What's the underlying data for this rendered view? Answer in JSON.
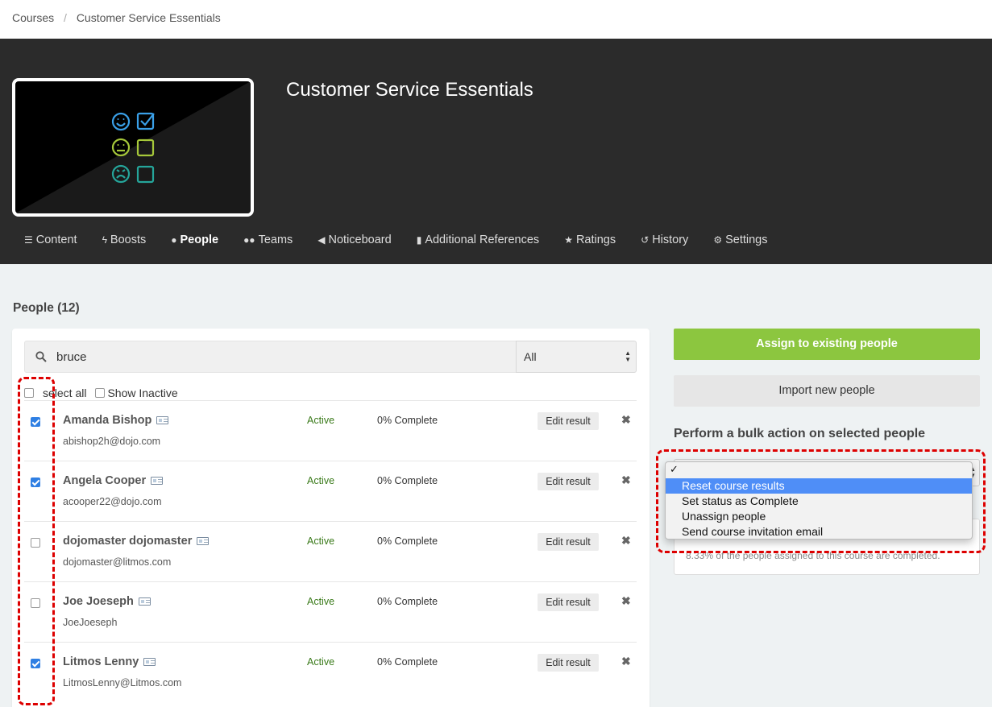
{
  "breadcrumb": {
    "root": "Courses",
    "separator": "/",
    "current": "Customer Service Essentials"
  },
  "course": {
    "title": "Customer Service Essentials"
  },
  "tabs": [
    {
      "label": "Content",
      "icon": "list-icon"
    },
    {
      "label": "Boosts",
      "icon": "bolt-icon"
    },
    {
      "label": "People",
      "icon": "user-icon",
      "active": true
    },
    {
      "label": "Teams",
      "icon": "users-icon"
    },
    {
      "label": "Noticeboard",
      "icon": "bullhorn-icon"
    },
    {
      "label": "Additional References",
      "icon": "file-icon"
    },
    {
      "label": "Ratings",
      "icon": "star-icon"
    },
    {
      "label": "History",
      "icon": "history-icon"
    },
    {
      "label": "Settings",
      "icon": "gear-icon"
    }
  ],
  "people": {
    "heading": "People (12)",
    "search_value": "bruce",
    "filter_value": "All",
    "select_all_label": "select all",
    "show_inactive_label": "Show Inactive",
    "edit_label": "Edit result",
    "rows": [
      {
        "name": "Amanda Bishop",
        "email": "abishop2h@dojo.com",
        "status": "Active",
        "progress": "0% Complete",
        "checked": true
      },
      {
        "name": "Angela Cooper",
        "email": "acooper22@dojo.com",
        "status": "Active",
        "progress": "0% Complete",
        "checked": true
      },
      {
        "name": "dojomaster dojomaster",
        "email": "dojomaster@litmos.com",
        "status": "Active",
        "progress": "0% Complete",
        "checked": false
      },
      {
        "name": "Joe Joeseph",
        "email": "JoeJoeseph",
        "status": "Active",
        "progress": "0% Complete",
        "checked": false
      },
      {
        "name": "Litmos Lenny",
        "email": "LitmosLenny@Litmos.com",
        "status": "Active",
        "progress": "0% Complete",
        "checked": true
      }
    ]
  },
  "sidebar": {
    "assign_label": "Assign to existing people",
    "import_label": "Import new people",
    "bulk_heading": "Perform a bulk action on selected people",
    "bulk_check": "✓",
    "bulk_options": [
      "Reset course results",
      "Set status as Complete",
      "Unassign people",
      "Send course invitation email"
    ],
    "highlighted_option": "Reset course results",
    "completion_text": "8.33% of the people assigned to this course are completed."
  },
  "colors": {
    "accent_green": "#8cc63f",
    "highlight_blue": "#4f8ef7",
    "annotation_red": "#dd0000",
    "status_green": "#3a7a1a"
  }
}
